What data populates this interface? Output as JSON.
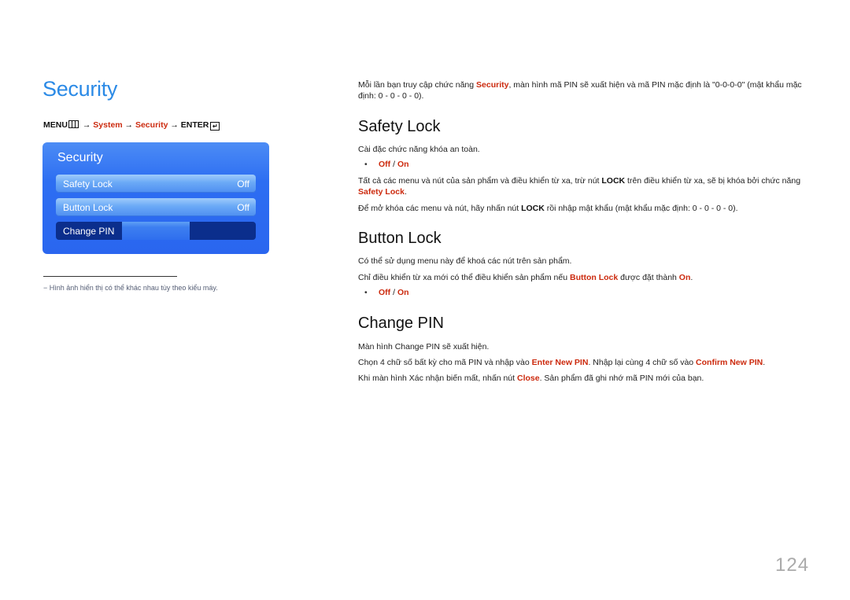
{
  "left": {
    "title": "Security",
    "breadcrumb": {
      "menu": "MENU",
      "arrow": "→",
      "system": "System",
      "security": "Security",
      "enter": "ENTER"
    },
    "panel": {
      "title": "Security",
      "items": [
        {
          "label": "Safety Lock",
          "value": "Off"
        },
        {
          "label": "Button Lock",
          "value": "Off"
        },
        {
          "label": "Change PIN",
          "value": ""
        }
      ]
    },
    "footnote": "−  Hình ảnh hiển thị có thể khác nhau tùy theo kiểu máy."
  },
  "intro": {
    "part1": "Mỗi lần bạn truy cập chức năng ",
    "security": "Security",
    "part2": ", màn hình mã PIN sẽ xuất hiện và mã PIN mặc định là \"0-0-0-0\" (mật khẩu mặc định: 0 - 0 - 0 - 0)."
  },
  "safety_lock": {
    "heading": "Safety Lock",
    "desc": "Cài đặc chức năng khóa an toàn.",
    "opt_off": "Off",
    "opt_sep": " / ",
    "opt_on": "On",
    "p1_a": "Tất cả các menu và nút của sản phẩm và điều khiển từ xa, trừ nút ",
    "p1_lock": "LOCK",
    "p1_b": " trên điều khiển từ xa, sẽ bị khóa bởi chức năng ",
    "p1_link": "Safety Lock",
    "p1_end": ".",
    "p2_a": "Để mở khóa các menu và nút, hãy nhấn nút ",
    "p2_lock": "LOCK",
    "p2_b": " rồi nhập mật khẩu (mật khẩu mặc định: 0 - 0 - 0 - 0)."
  },
  "button_lock": {
    "heading": "Button Lock",
    "desc": "Có thể sử dụng menu này để khoá các nút trên sản phẩm.",
    "p1_a": "Chỉ điều khiển từ xa mới có thể điều khiển sản phẩm nếu ",
    "p1_link": "Button Lock",
    "p1_b": " được đặt thành ",
    "p1_on": "On",
    "p1_end": ".",
    "opt_off": "Off",
    "opt_sep": " / ",
    "opt_on": "On"
  },
  "change_pin": {
    "heading": "Change PIN",
    "desc": "Màn hình Change PIN sẽ xuất hiện.",
    "p1_a": "Chọn 4 chữ số bất kỳ cho mã PIN và nhập vào ",
    "p1_enter": "Enter New PIN",
    "p1_b": ". Nhập lại cùng 4 chữ số vào ",
    "p1_confirm": "Confirm New PIN",
    "p1_end": ".",
    "p2_a": "Khi màn hình Xác nhận biến mất, nhấn nút ",
    "p2_close": "Close",
    "p2_b": ". Sản phẩm đã ghi nhớ mã PIN mới của bạn."
  },
  "page_number": "124"
}
